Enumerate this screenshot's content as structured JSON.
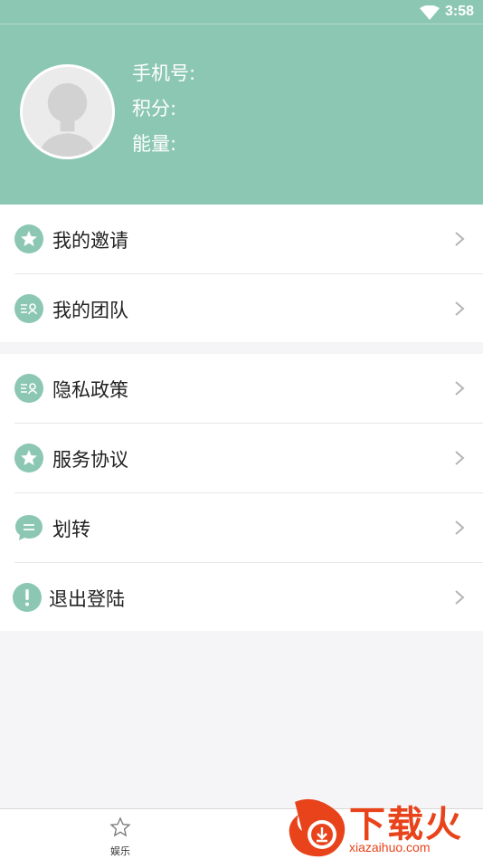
{
  "status_bar": {
    "time": "3:58"
  },
  "profile": {
    "phone_label": "手机号:",
    "points_label": "积分:",
    "energy_label": "能量:"
  },
  "menu_group_1": [
    {
      "label": "我的邀请",
      "icon": "star-icon"
    },
    {
      "label": "我的团队",
      "icon": "team-icon"
    }
  ],
  "menu_group_2": [
    {
      "label": "隐私政策",
      "icon": "team-icon"
    },
    {
      "label": "服务协议",
      "icon": "star-icon"
    },
    {
      "label": "划转",
      "icon": "chat-icon"
    },
    {
      "label": "退出登陆",
      "icon": "exclamation-icon"
    }
  ],
  "bottom_nav": {
    "tab_label": "娱乐",
    "icon": "star-outline-icon"
  },
  "watermark": {
    "text": "下载火",
    "url": "xiazaihuo.com"
  },
  "colors": {
    "accent": "#8cc7b4",
    "background": "#f5f5f7",
    "watermark": "#e8431a"
  }
}
